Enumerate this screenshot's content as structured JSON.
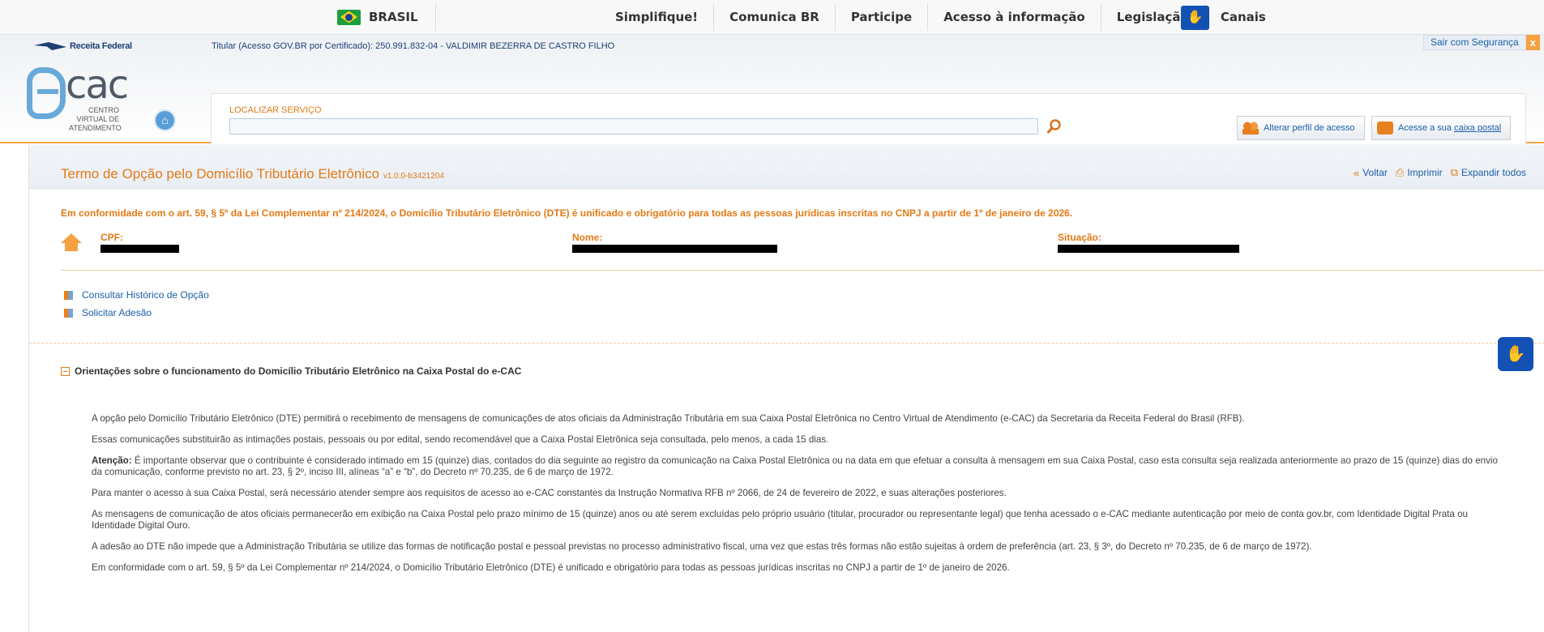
{
  "govbar": {
    "brasil": "BRASIL",
    "links": [
      "Simplifique!",
      "Comunica BR",
      "Participe",
      "Acesso à informação",
      "Legislação",
      "Canais"
    ]
  },
  "header": {
    "rf_logo": "Receita Federal",
    "titular": "Titular (Acesso GOV.BR por Certificado): 250.991.832-04 - VALDIMIR BEZERRA DE CASTRO FILHO",
    "logout": "Sair com Segurança",
    "logout_close": "x",
    "ecac_name": "cac",
    "ecac_sub": "CENTRO VIRTUAL DE ATENDIMENTO",
    "search_label": "LOCALIZAR SERVIÇO",
    "search_value": "",
    "alterar_perfil": "Alterar perfil de acesso",
    "caixa_prefix": "Acesse a sua ",
    "caixa_link": "caixa postal"
  },
  "page": {
    "title": "Termo de Opção pelo Domicílio Tributário Eletrônico",
    "version": "v1.0.0-b3421204",
    "actions": {
      "voltar": "Voltar",
      "imprimir": "Imprimir",
      "expandir": "Expandir todos"
    },
    "notice": "Em conformidade com o art. 59, § 5º da Lei Complementar nº 214/2024, o Domicílio Tributário Eletrônico (DTE) é unificado e obrigatório para todas as pessoas jurídicas inscritas no CNPJ a partir de 1º de janeiro de 2026.",
    "fields": {
      "cpf_label": "CPF:",
      "nome_label": "Nome:",
      "situacao_label": "Situação:"
    },
    "links": [
      "Consultar Histórico de Opção",
      "Solicitar Adesão"
    ],
    "section_title": "Orientações sobre o funcionamento do Domicílio Tributário Eletrônico na Caixa Postal do e-CAC",
    "paragraphs": {
      "p1": "A opção pelo Domicílio Tributário Eletrônico (DTE) permitirá o recebimento de mensagens de comunicações de atos oficiais da Administração Tributária em sua Caixa Postal Eletrônica no Centro Virtual de Atendimento (e-CAC) da Secretaria da Receita Federal do Brasil (RFB).",
      "p2": "Essas comunicações substituirão as intimações postais, pessoais ou por edital, sendo recomendável que a Caixa Postal Eletrônica seja consultada, pelo menos, a cada 15 dias.",
      "p3_bold": "Atenção:",
      "p3": " É importante observar que o contribuinte é considerado intimado em 15 (quinze) dias, contados do dia seguinte ao registro da comunicação na Caixa Postal Eletrônica ou na data em que efetuar a consulta à mensagem em sua Caixa Postal, caso esta consulta seja realizada anteriormente ao prazo de 15 (quinze) dias do envio da comunicação, conforme previsto no art. 23, § 2º, inciso III, alíneas “a” e “b”, do Decreto nº 70.235, de 6 de março de 1972.",
      "p4": "Para manter o acesso à sua Caixa Postal, será necessário atender sempre aos requisitos de acesso ao e-CAC constantes da Instrução Normativa RFB nº 2066, de 24 de fevereiro de 2022, e suas alterações posteriores.",
      "p5": "As mensagens de comunicação de atos oficiais permanecerão em exibição na Caixa Postal pelo prazo mínimo de 15 (quinze) anos ou até serem excluídas pelo próprio usuário (titular, procurador ou representante legal) que tenha acessado o e-CAC mediante autenticação por meio de conta gov.br, com Identidade Digital Prata ou Identidade Digital Ouro.",
      "p6": "A adesão ao DTE não impede que a Administração Tributária se utilize das formas de notificação postal e pessoal previstas no processo administrativo fiscal, uma vez que estas três formas não estão sujeitas à ordem de preferência (art. 23, § 3º, do Decreto nº 70.235, de 6 de março de 1972).",
      "p7": "Em conformidade com o art. 59, § 5º da Lei Complementar nº 214/2024, o Domicílio Tributário Eletrônico (DTE) é unificado e obrigatório para todas as pessoas jurídicas inscritas no CNPJ a partir de 1º de janeiro de 2026."
    }
  },
  "icons": [
    "flag-icon",
    "accessibility-icon",
    "home-icon",
    "search-icon",
    "users-icon",
    "mail-icon",
    "back-icon",
    "print-icon",
    "expand-icon",
    "house-icon",
    "bullet-icon",
    "collapse-icon"
  ],
  "colors": {
    "accent_orange": "#e37a16",
    "link_blue": "#1d5fa8",
    "gov_blue": "#1351b4"
  }
}
